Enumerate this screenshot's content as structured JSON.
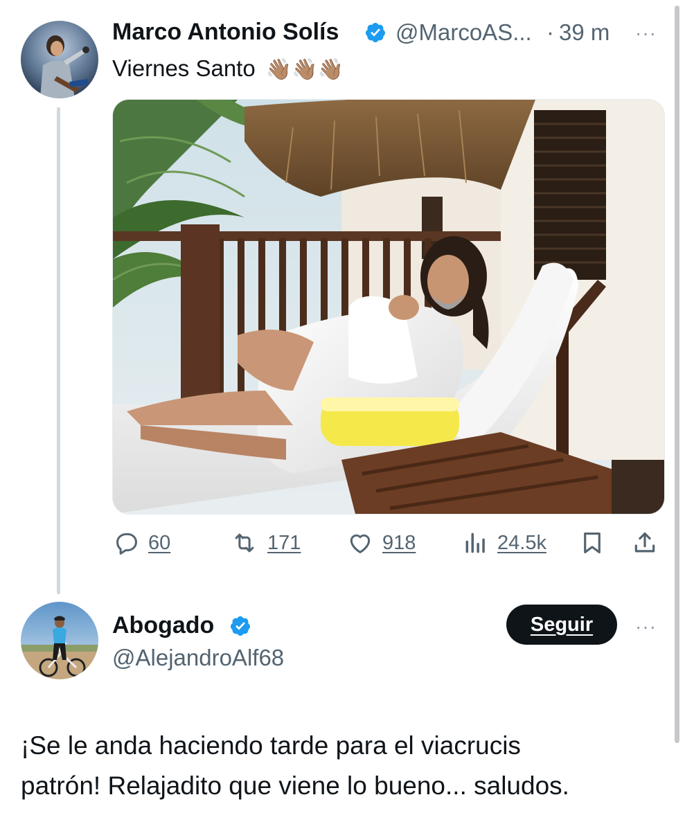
{
  "tweet": {
    "author_name": "Marco Antonio Solís",
    "handle": "@MarcoAS...",
    "separator": "·",
    "time": "39 m",
    "more": "···",
    "text": "Viernes Santo",
    "emoji": "👋🏽👋🏽👋🏽",
    "actions": {
      "replies": "60",
      "retweets": "171",
      "likes": "918",
      "views": "24.5k"
    }
  },
  "reply": {
    "author_name": "Abogado",
    "handle": "@AlejandroAlf68",
    "follow_label": "Seguir",
    "more": "···",
    "text_line1": "¡Se le anda haciendo tarde para el viacrucis",
    "text_line2": "patrón! Relajadito que viene lo bueno... saludos."
  },
  "colors": {
    "verified": "#1d9bf0",
    "muted": "#536471",
    "thread_line": "#cfd9de"
  }
}
